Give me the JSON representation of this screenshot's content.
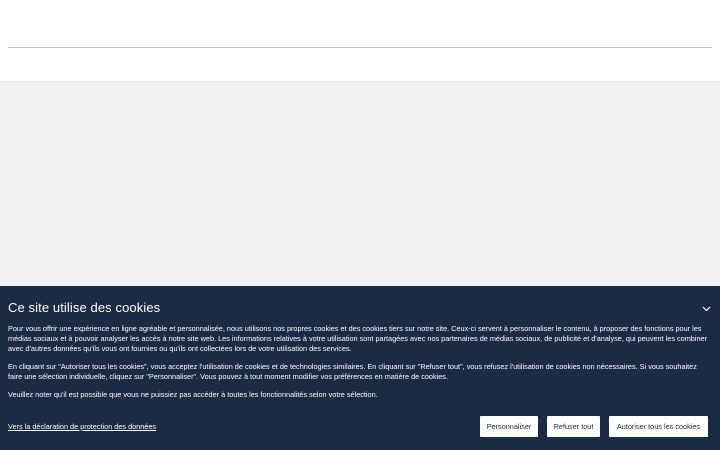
{
  "cookie_banner": {
    "title": "Ce site utilise des cookies",
    "paragraphs": [
      "Pour vous offrir une expérience en ligne agréable et personnalisée, nous utilisons nos propres cookies et des cookies tiers sur notre site. Ceux-ci servent à personnaliser le contenu, à proposer des fonctions pour les médias sociaux et à pouvoir analyser les accès à notre site web. Les informations relatives à votre utilisation sont partagées avec nos partenaires de médias sociaux, de publicité et d'analyse, qui peuvent les combiner avec d'autres données qu'ils vous ont fournies ou qu'ils ont collectées lors de votre utilisation des services.",
      "En cliquant sur \"Autoriser tous les cookies\", vous acceptez l'utilisation de cookies et de technologies similaires. En cliquant sur \"Refuser tout\", vous refusez l'utilisation de cookies non nécessaires. Si vous souhaitez faire une sélection individuelle, cliquez sur \"Personnaliser\". Vous pouvez à tout moment modifier vos préférences en matière de cookies.",
      "Veuillez noter qu'il est possible que vous ne puissiez pas accéder à toutes les fonctionnalités selon votre sélection."
    ],
    "privacy_link": "Vers la déclaration de protection des données",
    "buttons": {
      "personalize": "Personnaliser",
      "refuse_all": "Refuser tout",
      "accept_all": "Autoriser tous les cookies"
    },
    "toggle_icon": "chevron-down-icon"
  },
  "colors": {
    "banner_background": "#1b2a45",
    "page_background": "#f1f1f3",
    "header_background": "#ffffff",
    "button_background": "#ffffff",
    "button_text": "#1b2a45"
  }
}
